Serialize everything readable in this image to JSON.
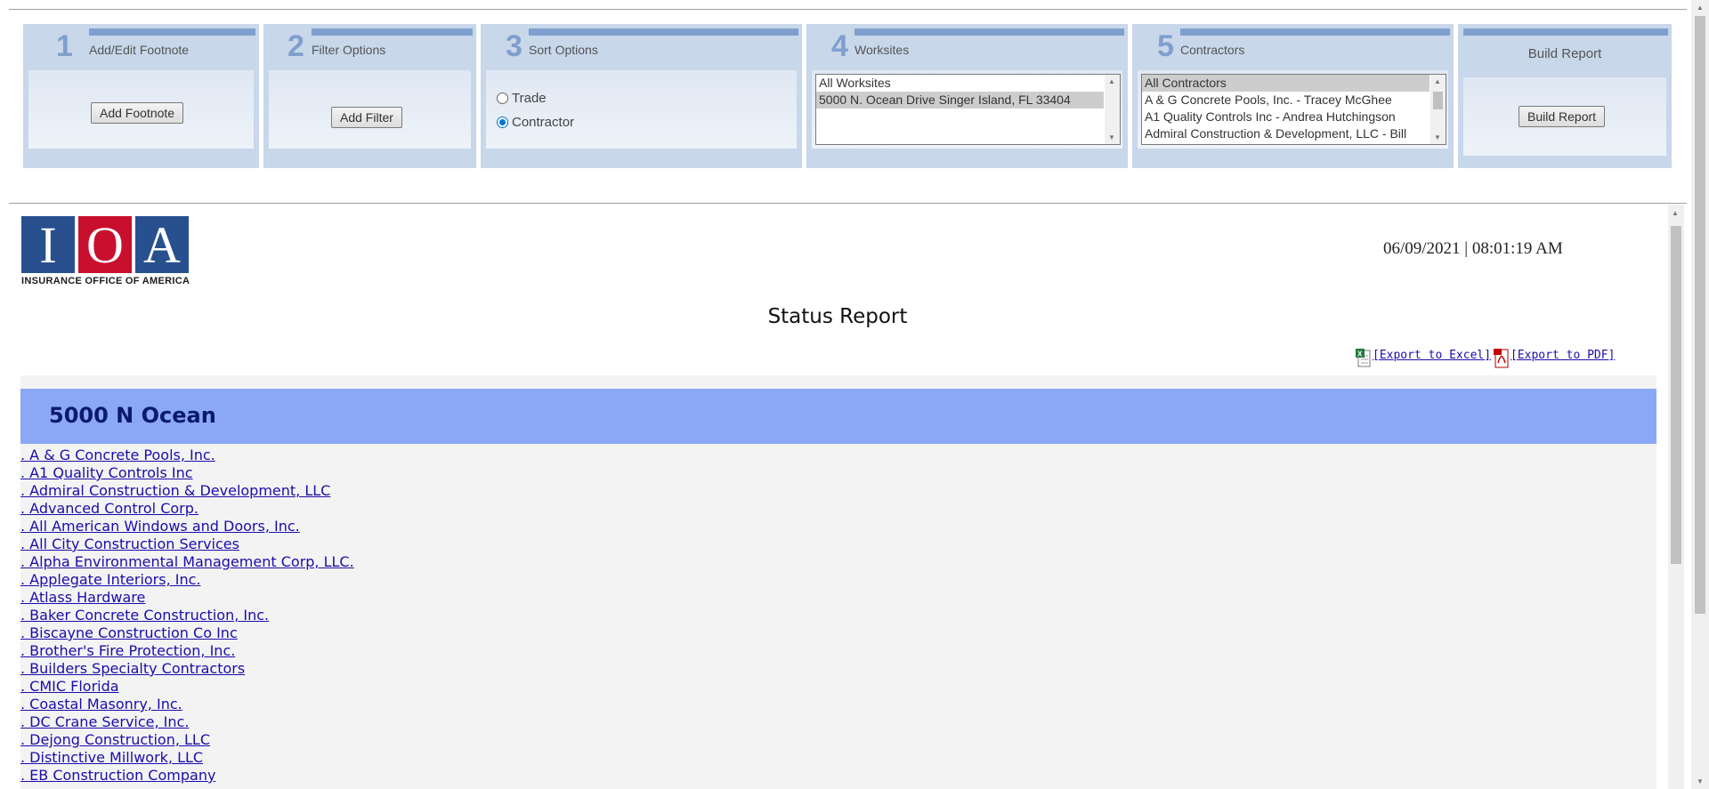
{
  "steps": [
    {
      "number": "1",
      "title": "Add/Edit Footnote",
      "button": "Add Footnote"
    },
    {
      "number": "2",
      "title": "Filter Options",
      "button": "Add Filter"
    },
    {
      "number": "3",
      "title": "Sort Options",
      "radios": [
        {
          "label": "Trade",
          "checked": false
        },
        {
          "label": "Contractor",
          "checked": true
        }
      ]
    },
    {
      "number": "4",
      "title": "Worksites",
      "options": [
        "All Worksites",
        "5000 N. Ocean Drive Singer Island, FL 33404"
      ],
      "selected": "5000 N. Ocean Drive Singer Island, FL 33404"
    },
    {
      "number": "5",
      "title": "Contractors",
      "options": [
        "All Contractors",
        "A & G Concrete Pools, Inc. - Tracey McGhee",
        "A1 Quality Controls Inc - Andrea Hutchingson",
        "Admiral Construction & Development, LLC - Bill"
      ],
      "selected": "All Contractors"
    },
    {
      "title": "Build Report",
      "button": "Build Report"
    }
  ],
  "report": {
    "logo_letters": [
      "I",
      "O",
      "A"
    ],
    "logo_subtitle": "INSURANCE OFFICE OF AMERICA",
    "timestamp": "06/09/2021 | 08:01:19 AM",
    "title": "Status Report",
    "export_excel": "[Export to Excel]",
    "export_pdf": "[Export to PDF]",
    "site_name": "5000 N Ocean",
    "contractors": [
      ". A & G Concrete Pools, Inc.",
      ". A1 Quality Controls Inc",
      ". Admiral Construction & Development, LLC",
      ". Advanced Control Corp.",
      ". All American Windows and Doors, Inc.",
      ". All City Construction Services",
      ". Alpha Environmental Management Corp, LLC.",
      ". Applegate Interiors, Inc.",
      ". Atlass Hardware",
      ". Baker Concrete Construction, Inc.",
      ". Biscayne Construction Co Inc",
      ". Brother's Fire Protection, Inc.",
      ". Builders Specialty Contractors",
      ". CMIC Florida",
      ". Coastal Masonry, Inc.",
      ". DC Crane Service, Inc.",
      ". Dejong Construction, LLC",
      ". Distinctive Millwork, LLC",
      ". EB Construction Company"
    ]
  },
  "colors": {
    "panel": "#c8d7ea",
    "accent": "#7f9fce",
    "site_header": "#8aa8f5",
    "link": "#1a0dab"
  }
}
